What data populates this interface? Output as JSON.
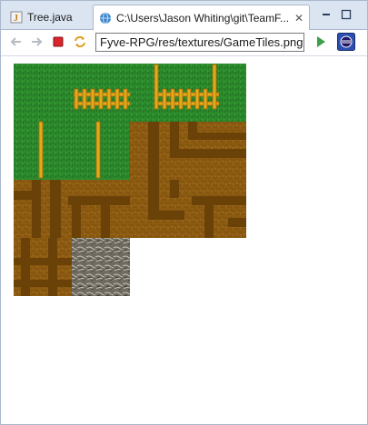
{
  "tabs": [
    {
      "label": "Tree.java",
      "icon": "java-file-icon"
    },
    {
      "label": "C:\\Users\\Jason Whiting\\git\\TeamF...",
      "icon": "browser-globe-icon"
    }
  ],
  "toolbar": {
    "url_value": "Fyve-RPG/res/textures/GameTiles.png"
  },
  "image": {
    "description_name": "GameTiles.png",
    "colors": {
      "grass": "#2c8a2c",
      "dirt": "#8d5c12",
      "path": "#6a4208",
      "fence": "#e3a81b",
      "stone": "#6f6b60"
    }
  }
}
